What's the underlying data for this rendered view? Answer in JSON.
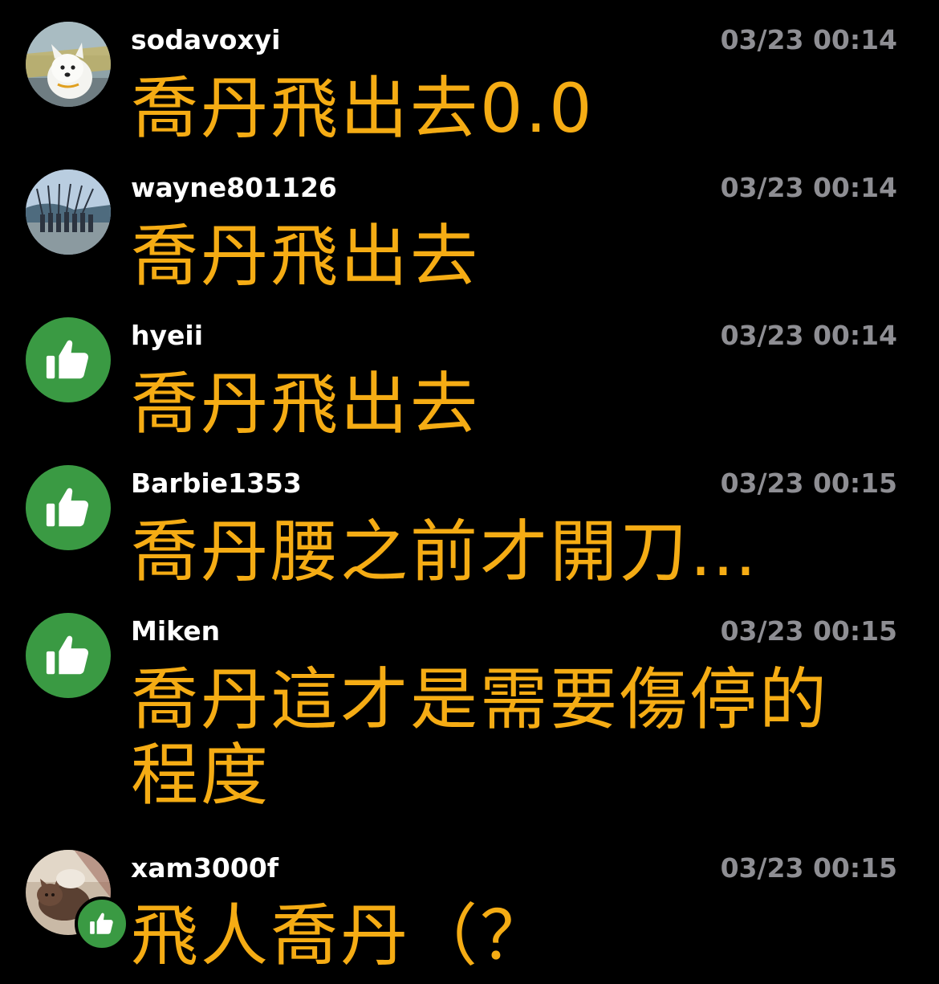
{
  "colors": {
    "background": "#000000",
    "username": "#ffffff",
    "timestamp": "#8e8e93",
    "message": "#f5ac14",
    "like_badge": "#3a9a43"
  },
  "comments": [
    {
      "username": "sodavoxyi",
      "time": "03/23 00:14",
      "text": "喬丹飛出去0.0",
      "avatar": "photo-white-dog"
    },
    {
      "username": "wayne801126",
      "time": "03/23 00:14",
      "text": "喬丹飛出去",
      "avatar": "photo-group-beach"
    },
    {
      "username": "hyeii",
      "time": "03/23 00:14",
      "text": "喬丹飛出去",
      "avatar": "thumbs-up-icon"
    },
    {
      "username": "Barbie1353",
      "time": "03/23 00:15",
      "text": "喬丹腰之前才開刀…",
      "avatar": "thumbs-up-icon"
    },
    {
      "username": "Miken",
      "time": "03/23 00:15",
      "text": "喬丹這才是需要傷停的程度",
      "avatar": "thumbs-up-icon"
    },
    {
      "username": "xam3000f",
      "time": "03/23 00:15",
      "text": "飛人喬丹（？",
      "avatar": "photo-cat",
      "badge": "thumbs-up-icon"
    }
  ]
}
